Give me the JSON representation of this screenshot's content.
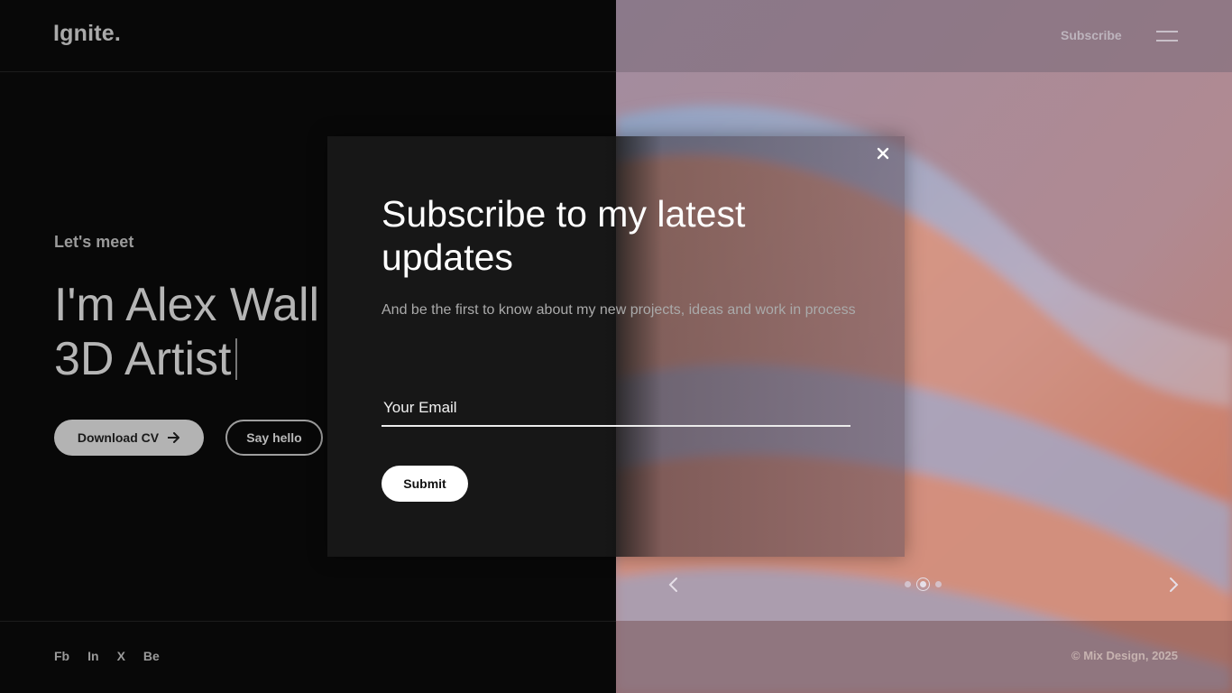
{
  "header": {
    "logo": "Ignite.",
    "subscribe_label": "Subscribe",
    "menu_icon": "hamburger-icon"
  },
  "hero": {
    "intro": "Let's meet",
    "headline_line1": "I'm Alex Wall",
    "headline_line2": "3D Artist",
    "download_label": "Download CV",
    "download_icon": "arrow-right-icon",
    "hello_label": "Say hello"
  },
  "footer": {
    "socials": [
      "Fb",
      "In",
      "X",
      "Be"
    ],
    "copyright": "© Mix Design, 2025"
  },
  "slider": {
    "prev_icon": "chevron-left-icon",
    "next_icon": "chevron-right-icon",
    "slide_count": 3,
    "active_index": 1
  },
  "modal": {
    "title": "Subscribe to my latest updates",
    "description": "And be the first to know about my new projects, ideas and work in process",
    "email_placeholder": "Your Email",
    "submit_label": "Submit",
    "close_icon": "close-icon"
  },
  "colors": {
    "left_bg": "#080808",
    "modal_bg": "#171717",
    "accent": "#ffffff"
  }
}
